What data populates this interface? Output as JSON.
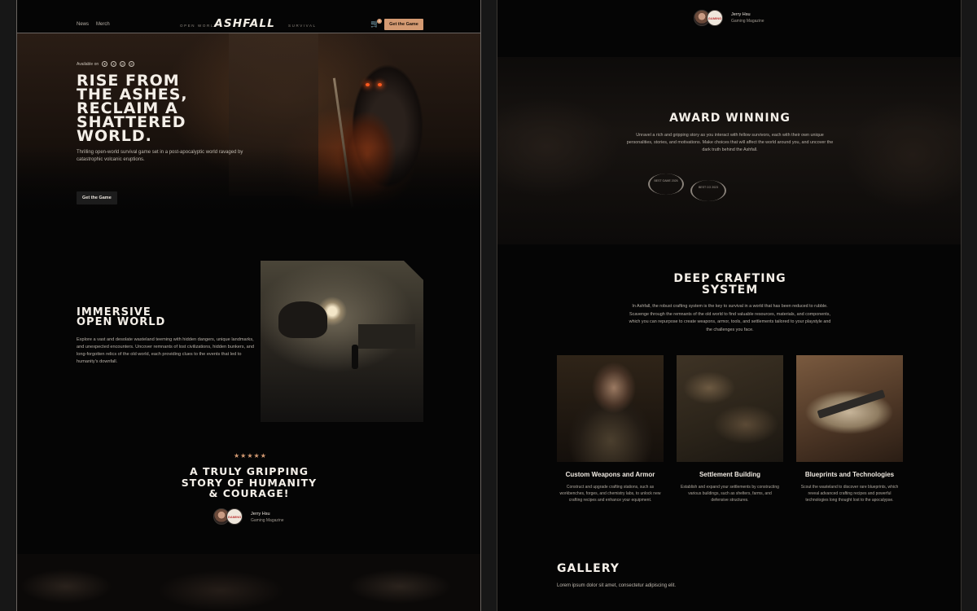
{
  "nav": {
    "links": [
      "News",
      "Merch"
    ],
    "tag_left": "OPEN WORLD",
    "logo": "ASHFALL",
    "tag_right": "SURVIVAL",
    "cart_count": "0",
    "cta": "Get the Game"
  },
  "hero": {
    "available_on": "Available on",
    "platforms": [
      "steam-icon",
      "xbox-icon",
      "playstation-icon",
      "epic-icon"
    ],
    "title_lines": [
      "RISE FROM",
      "THE ASHES,",
      "RECLAIM A",
      "SHATTERED",
      "WORLD."
    ],
    "subtitle": "Thrilling open-world survival game set in a post-apocalyptic world ravaged by catastrophic volcanic eruptions.",
    "cta": "Get the Game"
  },
  "open_world": {
    "title_lines": [
      "IMMERSIVE",
      "OPEN WORLD"
    ],
    "body": "Explore a vast and desolate wasteland teeming with hidden dangers, unique landmarks, and unexpected encounters. Uncover remnants of lost civilizations, hidden bunkers, and long-forgotten relics of the old world, each providing clues to the events that led to humanity's downfall."
  },
  "review": {
    "stars": "★★★★★",
    "quote_lines": [
      "A TRULY GRIPPING",
      "STORY OF HUMANITY",
      "& COURAGE!"
    ],
    "author": "Jerry Hsu",
    "publication": "Gaming Magazine"
  },
  "right_top_review": {
    "author": "Jerry Hsu",
    "publication": "Gaming Magazine"
  },
  "award": {
    "title": "AWARD WINNING",
    "body": "Unravel a rich and gripping story as you interact with fellow survivors, each with their own unique personalities, stories, and motivations. Make choices that will affect the world around you, and uncover the dark truth behind the Ashfall.",
    "badges": [
      "BEST GAME 2026",
      "BEST CO 2023"
    ]
  },
  "crafting": {
    "title_lines": [
      "DEEP CRAFTING",
      "SYSTEM"
    ],
    "body": "In Ashfall, the robust crafting system is the key to survival in a world that has been reduced to rubble. Scavenge through the remnants of the old world to find valuable resources, materials, and components, which you can repurpose to create weapons, armor, tools, and settlements tailored to your playstyle and the challenges you face.",
    "features": [
      {
        "title": "Custom Weapons and Armor",
        "desc": "Construct and upgrade crafting stations, such as workbenches, forges, and chemistry labs, to unlock new crafting recipes and enhance your equipment."
      },
      {
        "title": "Settlement Building",
        "desc": "Establish and expand your settlements by constructing various buildings, such as shelters, farms, and defensive structures."
      },
      {
        "title": "Blueprints and Technologies",
        "desc": "Scout the wasteland to discover rare blueprints, which reveal advanced crafting recipes and powerful technologies long thought lost to the apocalypse."
      }
    ]
  },
  "gallery": {
    "title": "GALLERY",
    "body": "Lorem ipsum dolor sit amet, consectetur adipiscing elit."
  },
  "colors": {
    "accent": "#d49a72",
    "background": "#050505",
    "ember": "#ff5a1e"
  }
}
